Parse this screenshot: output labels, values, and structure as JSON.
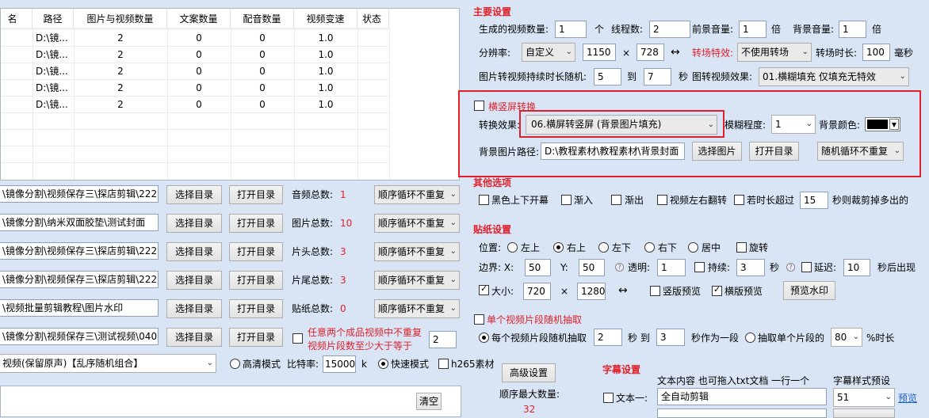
{
  "table": {
    "headers": [
      "名",
      "路径",
      "图片与视频数量",
      "文案数量",
      "配音数量",
      "视频变速",
      "状态"
    ],
    "rows": [
      [
        "D:\\镜...",
        "2",
        "0",
        "0",
        "1.0"
      ],
      [
        "D:\\镜...",
        "2",
        "0",
        "0",
        "1.0"
      ],
      [
        "D:\\镜...",
        "2",
        "0",
        "0",
        "1.0"
      ],
      [
        "D:\\镜...",
        "2",
        "0",
        "0",
        "1.0"
      ],
      [
        "D:\\镜...",
        "2",
        "0",
        "0",
        "1.0"
      ]
    ]
  },
  "left_rows": [
    {
      "path": "\\镜像分割\\视频保存三\\探店剪辑\\222",
      "label": "音频总数:",
      "count": "1"
    },
    {
      "path": "\\镜像分割\\纳米双面胶垫\\测试封面",
      "label": "图片总数:",
      "count": "10"
    },
    {
      "path": "\\镜像分割\\视频保存三\\探店剪辑\\222",
      "label": "片头总数:",
      "count": "3"
    },
    {
      "path": "\\镜像分割\\视频保存三\\探店剪辑\\222",
      "label": "片尾总数:",
      "count": "3"
    },
    {
      "path": "\\视频批量剪辑教程\\图片水印",
      "label": "贴纸总数:",
      "count": "0"
    },
    {
      "path": "\\镜像分割\\视频保存三\\测试视频\\040",
      "label": "",
      "count": ""
    }
  ],
  "left_common": {
    "select_dir": "选择目录",
    "open_dir": "打开目录",
    "order": "顺序循环不重复"
  },
  "random_combo": {
    "line1": "任意两个成品视频中不重复",
    "line2": "视频片段数至少大于等于",
    "value": "2"
  },
  "mode_bar": {
    "combo": "视频(保留原声)【乱序随机组合】",
    "hd": "高清模式",
    "bitrate_label": "比特率:",
    "bitrate": "15000",
    "k": "k",
    "fast": "快速模式",
    "h265": "h265素材"
  },
  "clear_btn": "清空",
  "main": {
    "title": "主要设置",
    "gen_count_label": "生成的视频数量:",
    "gen_count": "1",
    "ge": "个",
    "threads_label": "线程数:",
    "threads": "2",
    "fg_vol_label": "前景音量:",
    "fg_vol": "1",
    "bei": "倍",
    "bg_vol_label": "背景音量:",
    "bg_vol": "1",
    "res_label": "分辨率:",
    "res_mode": "自定义",
    "width": "1150",
    "x": "×",
    "height": "728",
    "swap": "↔",
    "transition_label": "转场特效:",
    "transition": "不使用转场",
    "trans_dur_label": "转场时长:",
    "trans_dur": "100",
    "ms": "毫秒",
    "img2vid_label": "图片转视频持续时长随机:",
    "dur_from": "5",
    "to": "到",
    "dur_to": "7",
    "sec": "秒",
    "img_effect_label": "图转视频效果:",
    "img_effect": "01.横糊填充 仅填充无特效"
  },
  "orient": {
    "title": "横竖屏转换",
    "effect_label": "转换效果:",
    "effect": "06.横屏转竖屏 (背景图片填充)",
    "blur_label": "模糊程度:",
    "blur": "1",
    "bgcolor_label": "背景颜色:",
    "bgpath_label": "背景图片路径:",
    "bgpath": "D:\\教程素材\\教程素材\\背景封面",
    "choose_img": "选择图片",
    "open_dir": "打开目录",
    "order": "随机循环不重复"
  },
  "other": {
    "title": "其他选项",
    "black_bars": "黑色上下开幕",
    "fade_in": "渐入",
    "fade_out": "渐出",
    "flip": "视频左右翻转",
    "over_label": "若时长超过",
    "over_value": "15",
    "over_tail": "秒则裁剪掉多出的"
  },
  "sticker": {
    "title": "贴纸设置",
    "pos_label": "位置:",
    "positions": [
      "左上",
      "右上",
      "左下",
      "右下",
      "居中"
    ],
    "rotate": "旋转",
    "border_label": "边界: X:",
    "bx": "50",
    "y_label": "Y:",
    "by": "50",
    "alpha_label": "透明:",
    "alpha": "1",
    "persist": "持续:",
    "persist_val": "3",
    "sec": "秒",
    "delay": "延迟:",
    "delay_val": "10",
    "delay_tail": "秒后出现",
    "size_label": "大小:",
    "sw": "720",
    "x": "×",
    "sh": "1280",
    "swap": "↔",
    "v_preview": "竖版预览",
    "h_preview": "横版预览",
    "preview_btn": "预览水印"
  },
  "segment": {
    "title": "单个视频片段随机抽取",
    "each": "每个视频片段随机抽取",
    "from": "2",
    "sec_to": "秒 到",
    "to": "3",
    "as_one": "秒作为一段",
    "single": "抽取单个片段的",
    "pct": "80",
    "pct_tail": "%时长"
  },
  "advanced": {
    "btn": "高级设置",
    "max_label": "顺序最大数量:",
    "max_value": "32"
  },
  "subtitle": {
    "title": "字幕设置",
    "content_label": "文本内容 也可拖入txt文档 一行一个",
    "style_label": "字幕样式预设",
    "text1": "文本一:",
    "text1_value": "全自动剪辑",
    "style_value": "51",
    "preview": "预览"
  }
}
